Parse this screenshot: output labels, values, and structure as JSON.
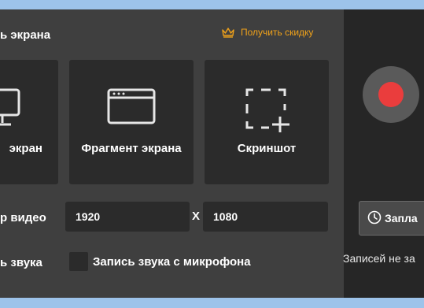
{
  "header": {
    "title": "ь экрана",
    "promo_label": "Получить скидку",
    "promo_icon": "crown-icon",
    "accent_color": "#f0a21a"
  },
  "modes": [
    {
      "label": "экран",
      "icon": "monitor-icon"
    },
    {
      "label": "Фрагмент экрана",
      "icon": "window-icon"
    },
    {
      "label": "Скриншот",
      "icon": "screenshot-icon"
    }
  ],
  "video_size": {
    "label": "р видео",
    "width": "1920",
    "separator": "X",
    "height": "1080"
  },
  "audio": {
    "system_label": "ь звука",
    "mic_label": "Запись звука с микрофона",
    "mic_checked": false
  },
  "right_panel": {
    "record_color": "#ea3d3d",
    "schedule_label": "Запла",
    "schedule_icon": "clock-icon",
    "status_text": "Записей не за"
  }
}
